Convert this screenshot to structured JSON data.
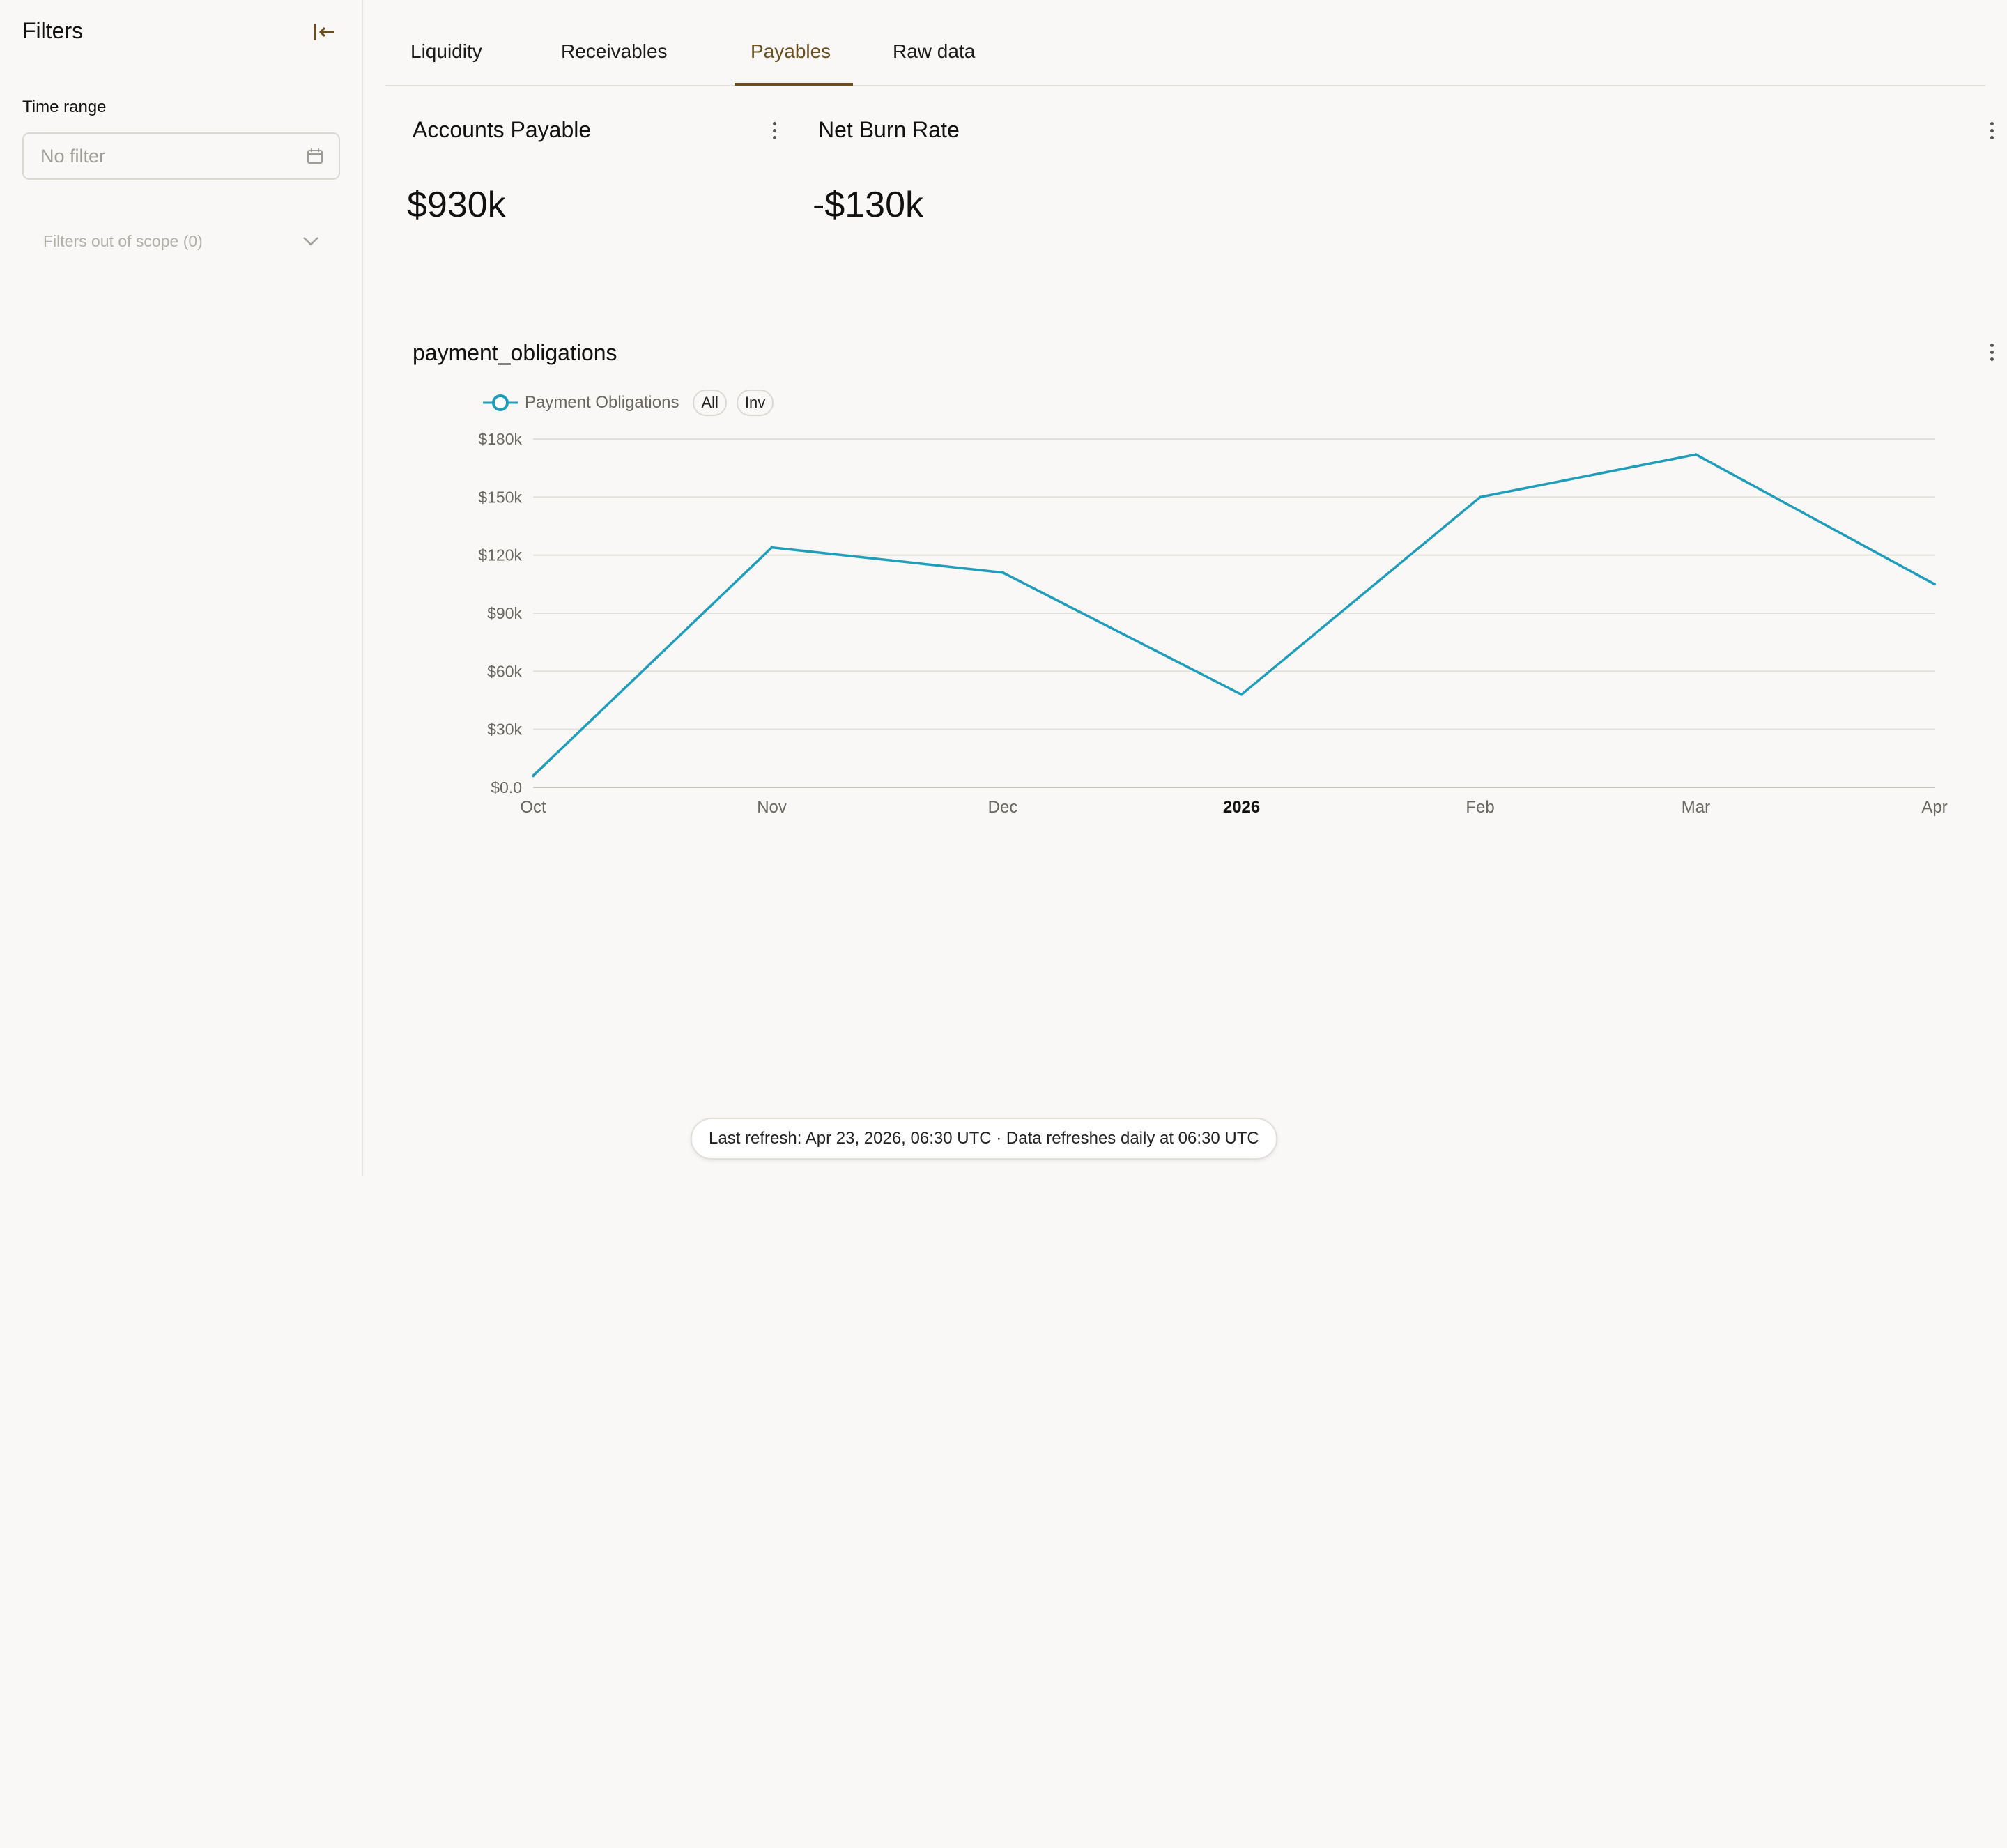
{
  "sidebar": {
    "title": "Filters",
    "time_range_label": "Time range",
    "date_placeholder": "No filter",
    "out_of_scope_label": "Filters out of scope (0)"
  },
  "tabs": [
    {
      "label": "Liquidity",
      "active": false
    },
    {
      "label": "Receivables",
      "active": false
    },
    {
      "label": "Payables",
      "active": true
    },
    {
      "label": "Raw data",
      "active": false
    }
  ],
  "kpis": {
    "accounts_payable": {
      "title": "Accounts Payable",
      "value": "$930k"
    },
    "net_burn_rate": {
      "title": "Net Burn Rate",
      "value": "-$130k"
    }
  },
  "chart_card": {
    "title": "payment_obligations",
    "legend_label": "Payment Obligations",
    "pill_all": "All",
    "pill_inv": "Inv"
  },
  "chart_data": {
    "type": "line",
    "title": "payment_obligations",
    "xlabel": "",
    "ylabel": "",
    "x": [
      "2025-10-01",
      "2025-11-01",
      "2025-12-01",
      "2026-01-01",
      "2026-02-01",
      "2026-03-01",
      "2026-04-01"
    ],
    "x_tick_labels": [
      "Oct",
      "Nov",
      "Dec",
      "2026",
      "Feb",
      "Mar",
      "Apr"
    ],
    "series": [
      {
        "name": "Payment Obligations",
        "values": [
          6000,
          124000,
          111000,
          48000,
          150000,
          172000,
          105000
        ]
      }
    ],
    "y_ticks": [
      0,
      30000,
      60000,
      90000,
      120000,
      150000,
      180000
    ],
    "y_tick_labels": [
      "$0.0",
      "$30k",
      "$60k",
      "$90k",
      "$120k",
      "$150k",
      "$180k"
    ],
    "ylim": [
      0,
      180000
    ],
    "grid": true,
    "legend": "top-left",
    "color": "#1f9dbb"
  },
  "footer": {
    "refresh_text": "Last refresh: Apr 23, 2026, 06:30 UTC · Data refreshes daily at 06:30 UTC"
  },
  "colors": {
    "accent": "#6b4e1e",
    "series": "#1f9dbb",
    "background": "#f9f8f6"
  }
}
